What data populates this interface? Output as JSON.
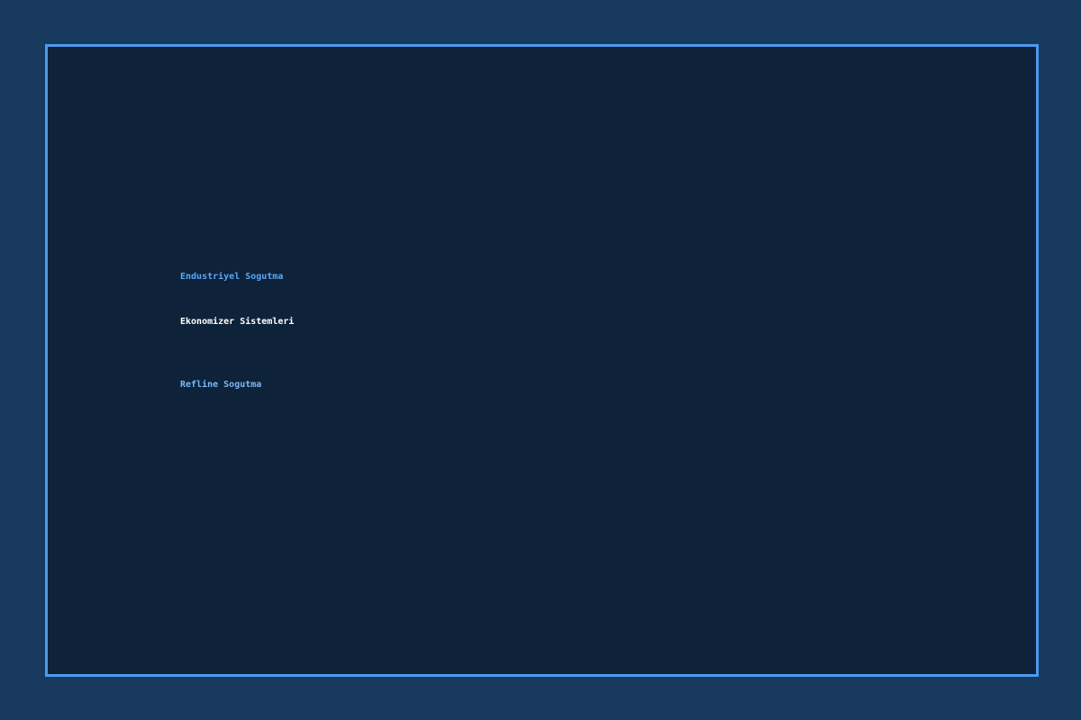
{
  "menu": {
    "items": [
      {
        "label": "Endustriyel Sogutma"
      },
      {
        "label": "Ekonomizer Sistemleri"
      },
      {
        "label": "Refline Sogutma"
      }
    ]
  }
}
